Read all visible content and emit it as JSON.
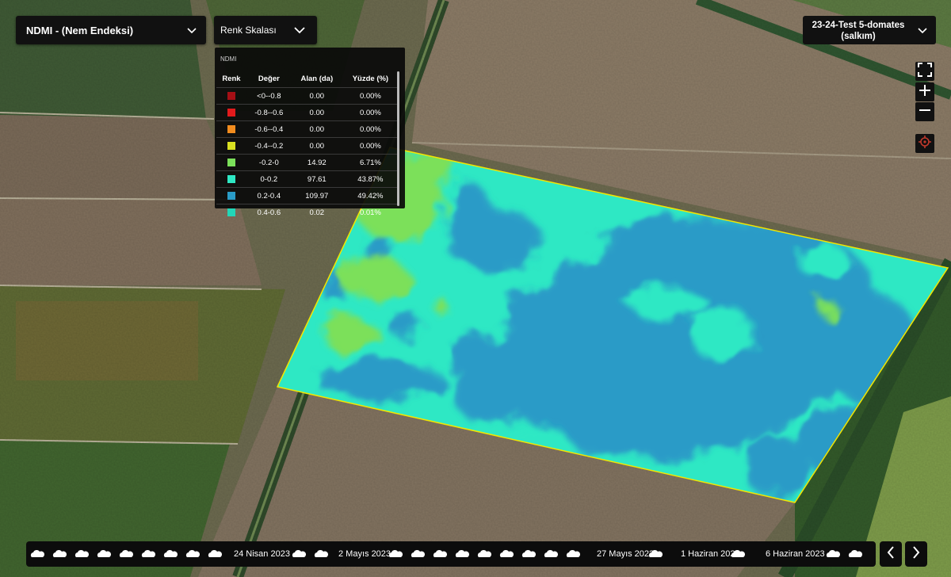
{
  "index_selector": {
    "label": "NDMI - (Nem Endeksi)"
  },
  "color_scale": {
    "label": "Renk Skalası",
    "legend_title": "NDMI",
    "headers": [
      "Renk",
      "Değer",
      "Alan (da)",
      "Yüzde (%)"
    ],
    "rows": [
      {
        "color": "#a50f15",
        "value": "<0--0.8",
        "area": "0.00",
        "percent": "0.00%"
      },
      {
        "color": "#e31a1c",
        "value": "-0.8--0.6",
        "area": "0.00",
        "percent": "0.00%"
      },
      {
        "color": "#f28c1e",
        "value": "-0.6--0.4",
        "area": "0.00",
        "percent": "0.00%"
      },
      {
        "color": "#d9e021",
        "value": "-0.4--0.2",
        "area": "0.00",
        "percent": "0.00%"
      },
      {
        "color": "#7be05a",
        "value": "-0.2-0",
        "area": "14.92",
        "percent": "6.71%"
      },
      {
        "color": "#2ee8c4",
        "value": "0-0.2",
        "area": "97.61",
        "percent": "43.87%"
      },
      {
        "color": "#2a9bc7",
        "value": "0.2-0.4",
        "area": "109.97",
        "percent": "49.42%"
      },
      {
        "color": "#22d6b8",
        "value": "0.4-0.6",
        "area": "0.02",
        "percent": "0.01%"
      }
    ]
  },
  "field_selector": {
    "line1": "23-24-Test 5-domates",
    "line2": "(salkım)"
  },
  "map_controls": [
    "fullscreen-icon",
    "zoom-in-icon",
    "zoom-out-icon",
    "locate-icon"
  ],
  "timeline": {
    "dates": [
      "24 Nisan 2023",
      "2 Mayıs 2023",
      "27 Mayıs 2023",
      "1 Haziran 2023",
      "6 Haziran 2023"
    ],
    "cloud_icon": "cloud-icon",
    "prev_icon": "chevron-left-icon",
    "next_icon": "chevron-right-icon"
  },
  "colors": {
    "field_high": "#2a9bc7",
    "field_mid": "#2ee8c4",
    "field_low": "#7be05a",
    "field_border": "#f2e600"
  }
}
